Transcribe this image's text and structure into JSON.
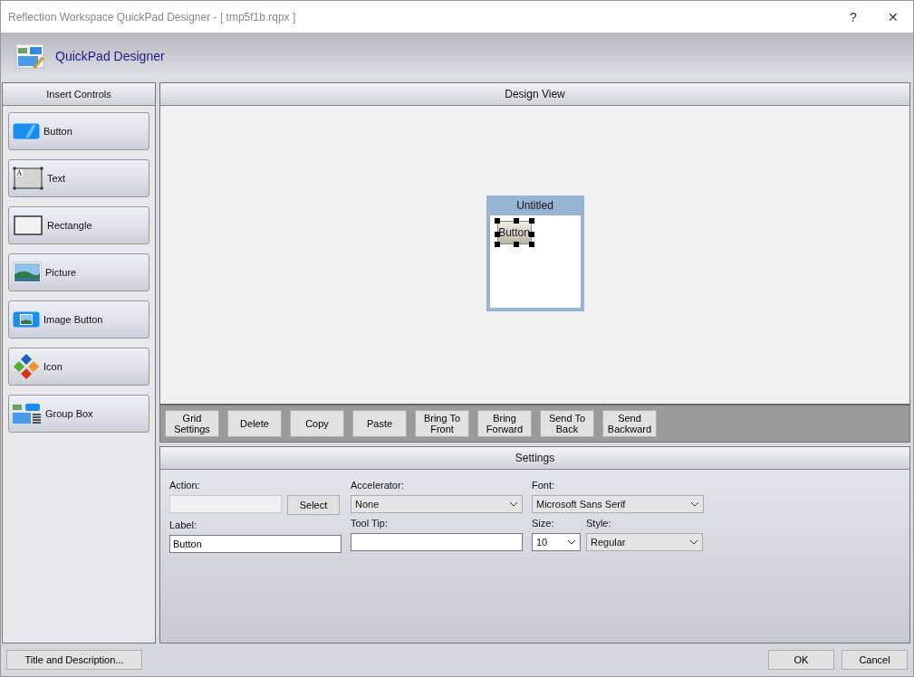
{
  "window": {
    "title": "Reflection Workspace QuickPad Designer - [ tmp5f1b.rqpx ]",
    "help": "?",
    "close": "✕"
  },
  "header": {
    "title": "QuickPad Designer"
  },
  "insert_controls": {
    "title": "Insert Controls",
    "items": [
      {
        "label": "Button",
        "kind": "button"
      },
      {
        "label": "Text",
        "kind": "text",
        "icon_text": "A"
      },
      {
        "label": "Rectangle",
        "kind": "rectangle"
      },
      {
        "label": "Picture",
        "kind": "picture"
      },
      {
        "label": "Image Button",
        "kind": "imagebutton"
      },
      {
        "label": "Icon",
        "kind": "icon"
      },
      {
        "label": "Group Box",
        "kind": "groupbox"
      }
    ]
  },
  "design_view": {
    "title": "Design View",
    "form": {
      "title": "Untitled",
      "button_label": "Button",
      "selected": true
    },
    "toolbar": [
      "Grid Settings",
      "Delete",
      "Copy",
      "Paste",
      "Bring To Front",
      "Bring Forward",
      "Send To Back",
      "Send Backward"
    ]
  },
  "settings": {
    "title": "Settings",
    "action": {
      "label": "Action:",
      "disabled": true,
      "button": "Select"
    },
    "accelerator": {
      "label": "Accelerator:",
      "value": "None"
    },
    "font": {
      "label": "Font:",
      "value": "Microsoft Sans Serif"
    },
    "label": {
      "label": "Label:",
      "value": "Button"
    },
    "tooltip": {
      "label": "Tool Tip:"
    },
    "size": {
      "label": "Size:",
      "value": "10"
    },
    "style": {
      "label": "Style:",
      "value": "Regular"
    }
  },
  "footer": {
    "left_button": "Title and Description...",
    "buttons": [
      "OK",
      "Cancel"
    ]
  }
}
